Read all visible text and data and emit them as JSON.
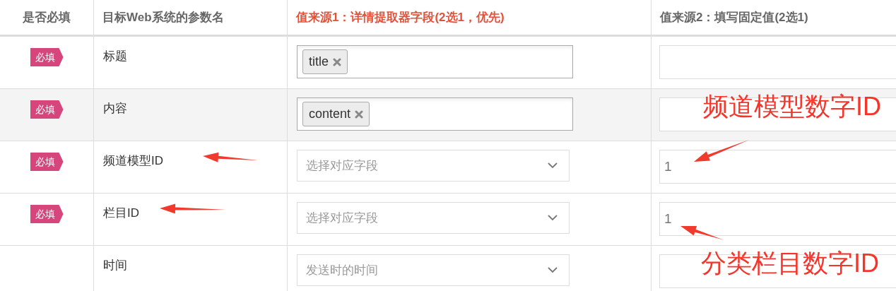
{
  "columns": [
    {
      "label": "是否必填",
      "highlighted": false
    },
    {
      "label": "目标Web系统的参数名",
      "highlighted": false
    },
    {
      "label": "值来源1：详情提取器字段(2选1，优先)",
      "highlighted": true
    },
    {
      "label": "值来源2：填写固定值(2选1)",
      "highlighted": false
    }
  ],
  "rows": [
    {
      "required": true,
      "badge": "必填",
      "name": "标题",
      "highlighted": false,
      "source1": {
        "kind": "tags",
        "tags": [
          "title"
        ]
      },
      "source2": {}
    },
    {
      "required": true,
      "badge": "必填",
      "name": "内容",
      "highlighted": true,
      "source1": {
        "kind": "tags",
        "tags": [
          "content"
        ]
      },
      "source2": {}
    },
    {
      "required": true,
      "badge": "必填",
      "name": "频道模型ID",
      "highlighted": false,
      "source1": {
        "kind": "select",
        "placeholder": "选择对应字段"
      },
      "source2": {
        "value": "1"
      }
    },
    {
      "required": true,
      "badge": "必填",
      "name": "栏目ID",
      "highlighted": false,
      "source1": {
        "kind": "select",
        "placeholder": "选择对应字段"
      },
      "source2": {
        "value": "1"
      }
    },
    {
      "required": false,
      "name": "时间",
      "highlighted": false,
      "source1": {
        "kind": "select",
        "placeholder": "发送时的时间"
      },
      "source2": {}
    }
  ],
  "annotations": [
    "频道模型数字ID",
    "分类栏目数字ID"
  ]
}
